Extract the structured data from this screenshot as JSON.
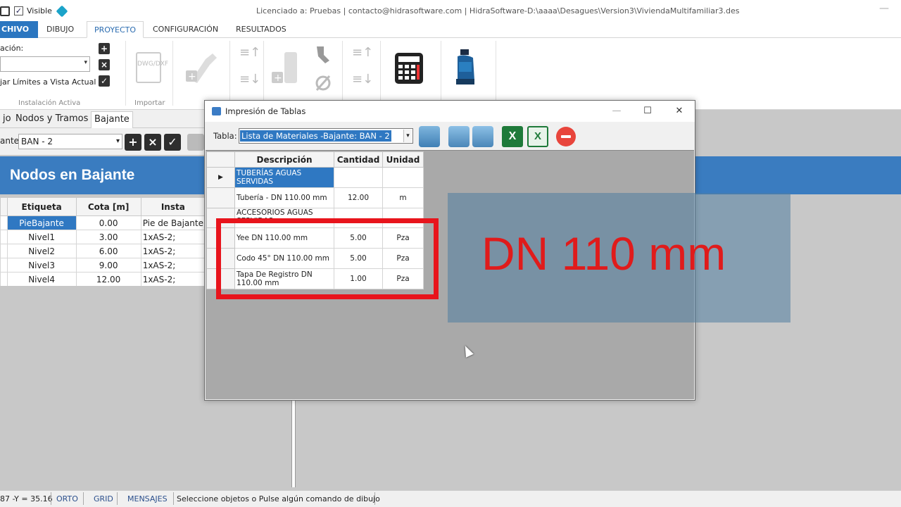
{
  "titlebar": {
    "visible_label": "Visible",
    "title": "Licenciado a: Pruebas | contacto@hidrasoftware.com | HidraSoftware-D:\\aaaa\\Desagues\\Version3\\ViviendaMultifamiliar3.des",
    "minimize": "—"
  },
  "ribbon_tabs": {
    "file": "CHIVO",
    "dibujo": "DIBUJO",
    "proyecto": "PROYECTO",
    "configuracion": "CONFIGURACIÓN",
    "resultados": "RESULTADOS"
  },
  "ribbon": {
    "instalacion_label": "ación:",
    "ajustar_label": "jar Límites a Vista Actual",
    "group_instalacion": "Instalación Activa",
    "group_importar": "Importar",
    "dwg_label": "DWG/\nDXF"
  },
  "subtabs": {
    "left_partial": "jo",
    "nodos_tramos": "Nodos y Tramos",
    "bajante": "Bajante"
  },
  "toolrow": {
    "label": "ante:",
    "value": "BAN - 2"
  },
  "nodos_band": {
    "title": "Nodos en Bajante"
  },
  "grid": {
    "headers": [
      "Etiqueta",
      "Cota [m]",
      "Insta"
    ],
    "rows": [
      [
        "PieBajante",
        "0.00",
        "Pie de Bajante"
      ],
      [
        "Nivel1",
        "3.00",
        "1xAS-2;"
      ],
      [
        "Nivel2",
        "6.00",
        "1xAS-2;"
      ],
      [
        "Nivel3",
        "9.00",
        "1xAS-2;"
      ],
      [
        "Nivel4",
        "12.00",
        "1xAS-2;"
      ]
    ]
  },
  "status": {
    "coords": "87 -Y = 35.16",
    "orto": "ORTO",
    "grid": "GRID",
    "mensajes": "MENSAJES",
    "message": "Seleccione objetos o Pulse algún comando de dibujo"
  },
  "dialog": {
    "title": "Impresión de Tablas",
    "tabla_label": "Tabla:",
    "tabla_value": "Lista de Materiales -Bajante: BAN - 2",
    "headers": [
      "Descripción",
      "Cantidad",
      "Unidad"
    ],
    "rows": [
      {
        "desc": "TUBERÍAS AGUAS SERVIDAS",
        "qty": "",
        "unit": ""
      },
      {
        "desc": "Tubería - DN 110.00 mm",
        "qty": "12.00",
        "unit": "m"
      },
      {
        "desc": "ACCESORIOS AGUAS SERVIDAS",
        "qty": "",
        "unit": ""
      },
      {
        "desc": "Yee DN 110.00 mm",
        "qty": "5.00",
        "unit": "Pza"
      },
      {
        "desc": "Codo 45° DN 110.00 mm",
        "qty": "5.00",
        "unit": "Pza"
      },
      {
        "desc": "Tapa De Registro DN 110.00 mm",
        "qty": "1.00",
        "unit": "Pza"
      }
    ],
    "row_marker": "▶",
    "excel_label": "X",
    "excel2_label": "X",
    "window_buttons": {
      "min": "—",
      "max": "☐",
      "close": "✕"
    }
  },
  "overlay": {
    "text": "DN 110 mm",
    "highlight_color": "#e8141c"
  }
}
